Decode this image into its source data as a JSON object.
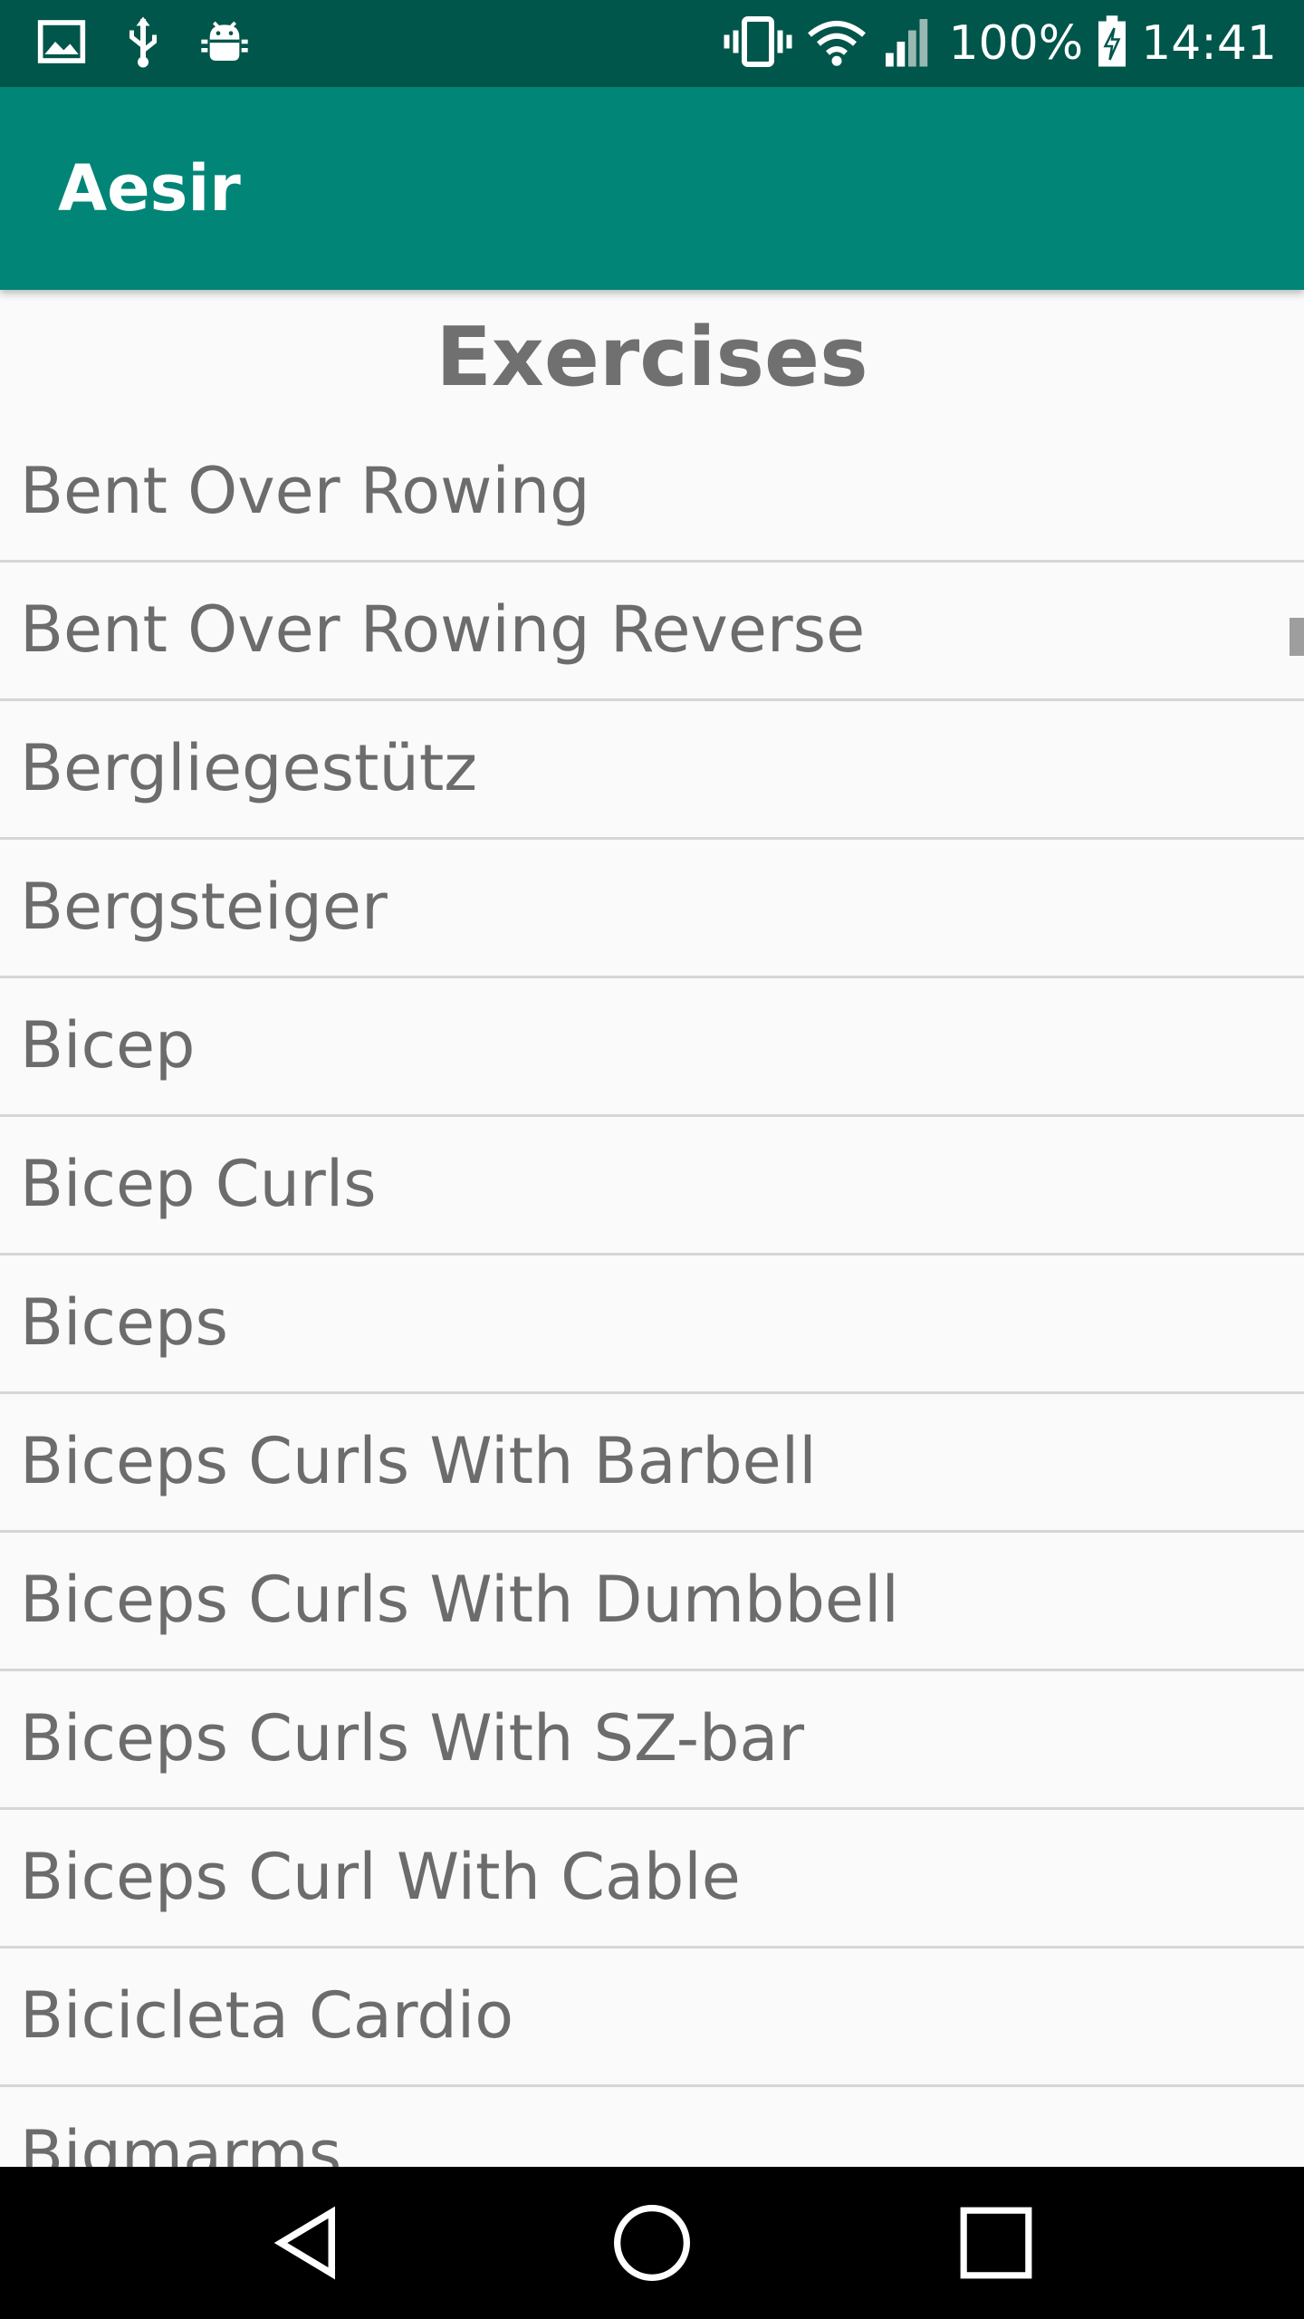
{
  "status_bar": {
    "battery": "100%",
    "time": "14:41",
    "icons": [
      "image-icon",
      "usb-icon",
      "android-debug-icon",
      "vibrate-icon",
      "wifi-icon",
      "signal-icon",
      "battery-charging-icon"
    ]
  },
  "app_bar": {
    "title": "Aesir"
  },
  "main": {
    "heading": "Exercises",
    "exercises": [
      "Bent Over Rowing",
      "Bent Over Rowing Reverse",
      "Bergliegestütz",
      "Bergsteiger",
      "Bicep",
      "Bicep Curls",
      "Biceps",
      "Biceps Curls With Barbell",
      "Biceps Curls With Dumbbell",
      "Biceps Curls With SZ-bar",
      "Biceps Curl With Cable",
      "Bicicleta Cardio",
      "Bigmarms"
    ]
  },
  "nav_bar": {
    "icons": [
      "back-icon",
      "home-icon",
      "recents-icon"
    ]
  },
  "colors": {
    "status_bar": "#00564b",
    "app_bar": "#008577",
    "text": "#6c6c6c"
  }
}
